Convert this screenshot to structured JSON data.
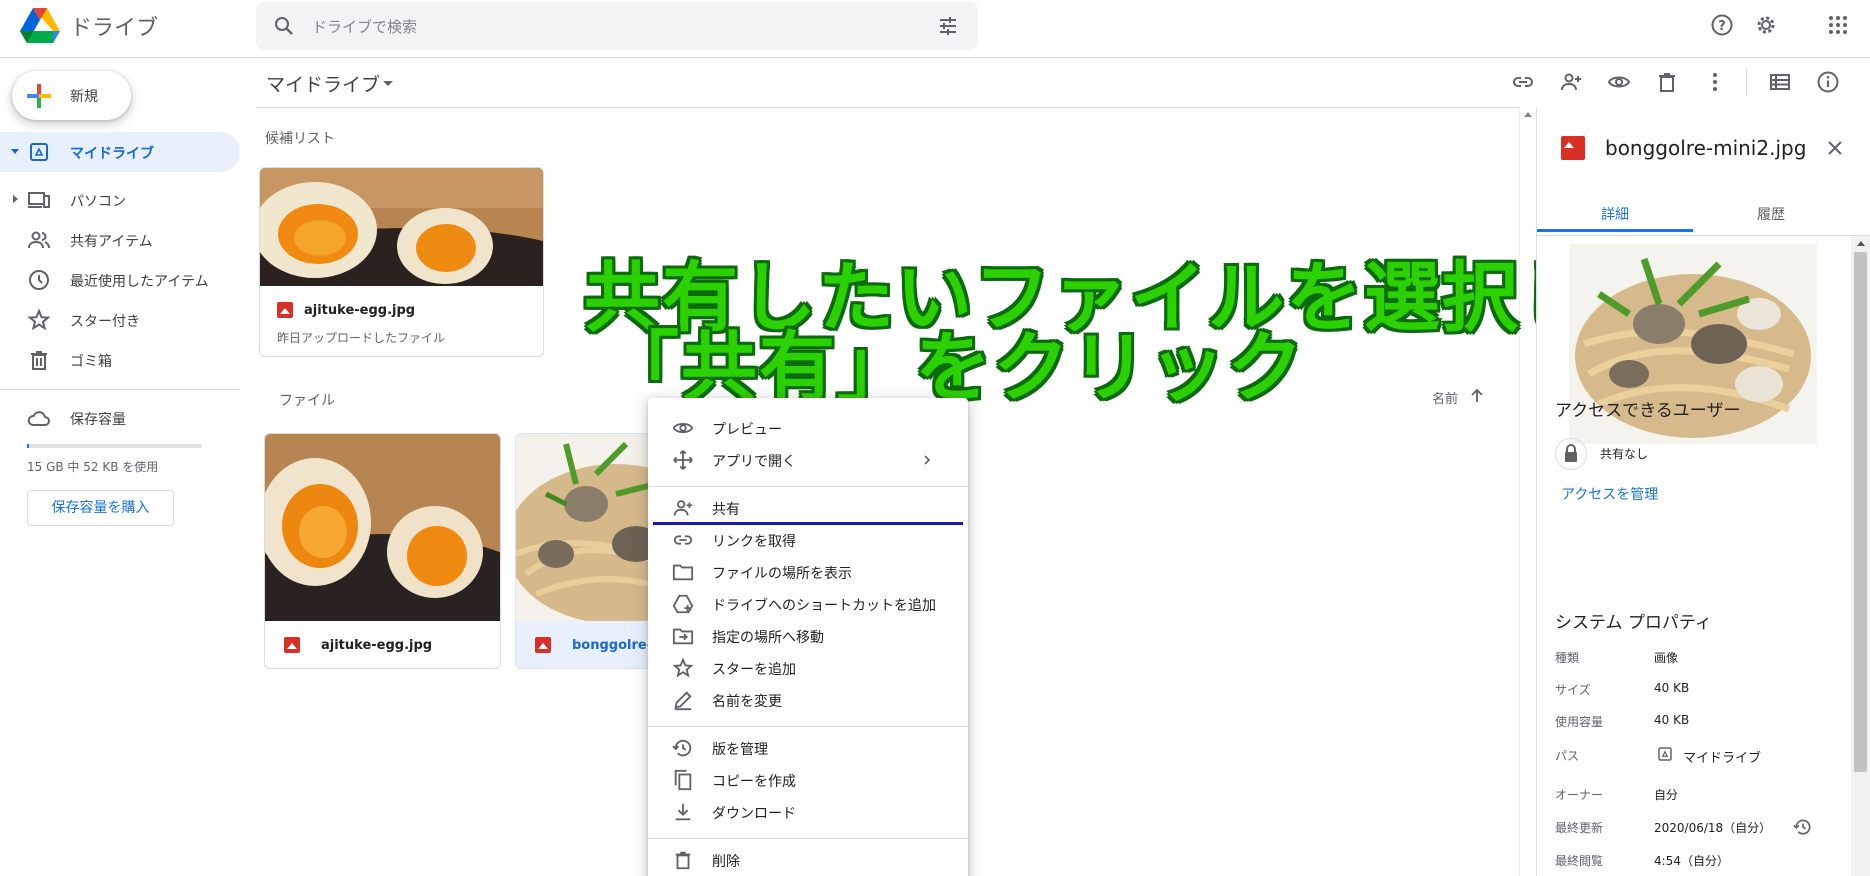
{
  "app": {
    "title": "ドライブ"
  },
  "search": {
    "placeholder": "ドライブで検索"
  },
  "nav": {
    "new_label": "新規",
    "items": [
      {
        "label": "マイドライブ"
      },
      {
        "label": "パソコン"
      },
      {
        "label": "共有アイテム"
      },
      {
        "label": "最近使用したアイテム"
      },
      {
        "label": "スター付き"
      },
      {
        "label": "ゴミ箱"
      }
    ],
    "storage": {
      "label": "保存容量",
      "usage": "15 GB 中 52 KB を使用",
      "used_fraction": 0.01,
      "buy_label": "保存容量を購入"
    }
  },
  "main": {
    "breadcrumb": "マイドライブ",
    "suggested": {
      "label": "候補リスト",
      "card": {
        "name": "ajituke-egg.jpg",
        "sub": "昨日アップロードしたファイル"
      }
    },
    "files": {
      "label": "ファイル",
      "sort_label": "名前",
      "items": [
        {
          "name": "ajituke-egg.jpg"
        },
        {
          "name": "bonggolre-mi"
        }
      ]
    }
  },
  "overlay": {
    "line1": "共有したいファイルを選択し",
    "line2": "「共有」をクリック",
    "color": "#2bd100"
  },
  "context_menu": {
    "items": [
      {
        "label": "プレビュー"
      },
      {
        "label": "アプリで開く"
      },
      {
        "label": "共有"
      },
      {
        "label": "リンクを取得"
      },
      {
        "label": "ファイルの場所を表示"
      },
      {
        "label": "ドライブへのショートカットを追加"
      },
      {
        "label": "指定の場所へ移動"
      },
      {
        "label": "スターを追加"
      },
      {
        "label": "名前を変更"
      },
      {
        "label": "版を管理"
      },
      {
        "label": "コピーを作成"
      },
      {
        "label": "ダウンロード"
      },
      {
        "label": "削除"
      }
    ]
  },
  "details": {
    "filename": "bonggolre-mini2.jpg",
    "tabs": [
      {
        "label": "詳細"
      },
      {
        "label": "履歴"
      }
    ],
    "access": {
      "title": "アクセスできるユーザー",
      "status": "共有なし",
      "manage_label": "アクセスを管理"
    },
    "system": {
      "title": "システム プロパティ",
      "rows": [
        {
          "key": "種類",
          "value": "画像"
        },
        {
          "key": "サイズ",
          "value": "40 KB"
        },
        {
          "key": "使用容量",
          "value": "40 KB"
        },
        {
          "key": "パス",
          "value": "マイドライブ"
        },
        {
          "key": "オーナー",
          "value": "自分"
        },
        {
          "key": "最終更新",
          "value": "2020/06/18（自分）"
        },
        {
          "key": "最終閲覧",
          "value": "4:54（自分）"
        }
      ]
    }
  },
  "colors": {
    "accent": "#1a73e8",
    "highlight_underline": "#1a1ab8"
  }
}
